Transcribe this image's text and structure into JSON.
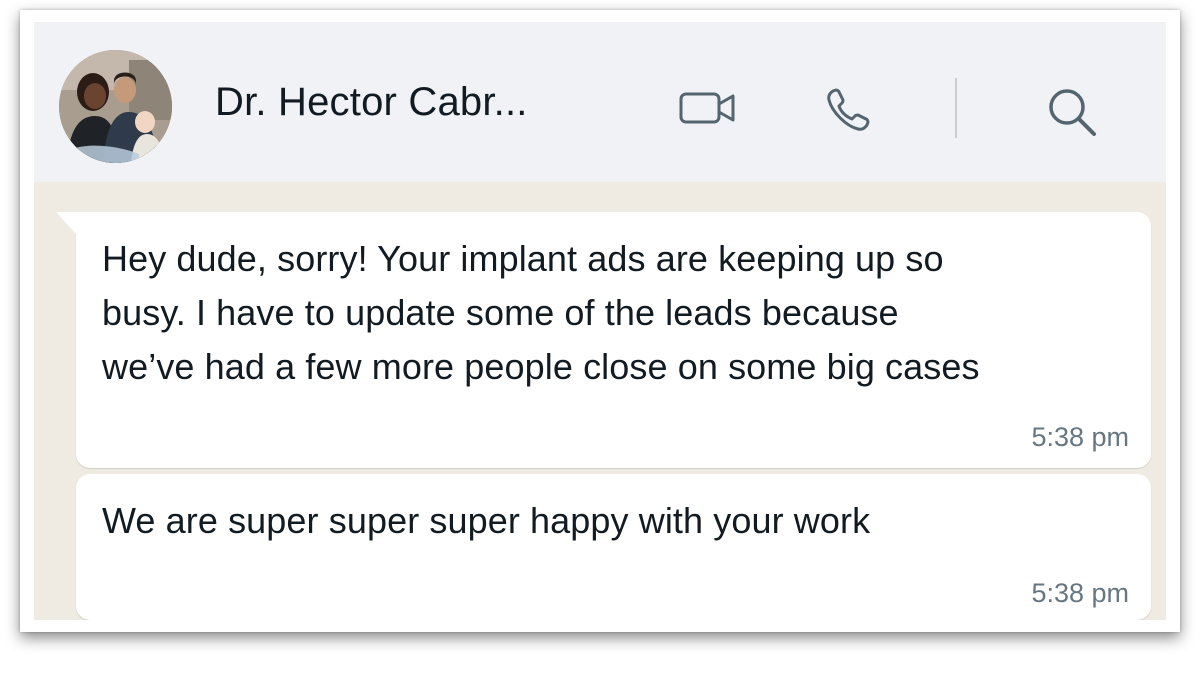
{
  "header": {
    "contact_name": "Dr. Hector Cabr...",
    "avatar_icon": "profile-photo-avatar",
    "actions": [
      {
        "name": "video-call",
        "icon": "video-camera-icon"
      },
      {
        "name": "voice-call",
        "icon": "phone-icon"
      },
      {
        "name": "search",
        "icon": "search-icon"
      }
    ]
  },
  "messages": [
    {
      "direction": "incoming",
      "lines": [
        "Hey dude, sorry! Your implant ads are keeping up so",
        "busy. I have to update some of the leads because",
        "we’ve had a few more people close on some big cases"
      ],
      "time": "5:38 pm"
    },
    {
      "direction": "incoming",
      "lines": [
        "We are super super super happy with your work"
      ],
      "time": "5:38 pm"
    }
  ],
  "colors": {
    "header_bg": "#f0f2f5",
    "chat_bg": "#efeae2",
    "bubble_bg": "#ffffff",
    "text": "#111b21",
    "timestamp": "#667781",
    "icon": "#54656f"
  }
}
